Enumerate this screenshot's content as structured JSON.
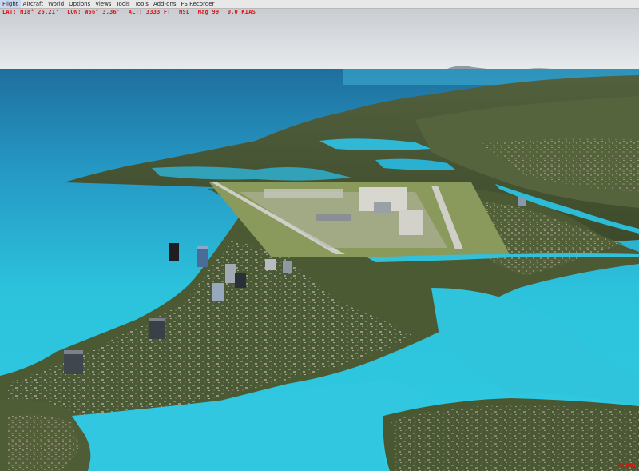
{
  "menu": {
    "items": [
      "Flight",
      "Aircraft",
      "World",
      "Options",
      "Views",
      "Tools",
      "Tools",
      "Add-ons",
      "FS Recorder"
    ]
  },
  "hud": {
    "lat": "LAT: N18° 26.21'",
    "lon": "LON: W66° 3.36'",
    "alt": "ALT: 3333 FT",
    "ref": "MSL",
    "mag": "Mag 99",
    "speed": "0.0 KIAS"
  },
  "status": {
    "label": "SLEW"
  },
  "colors": {
    "sky_top": "#c8ccd2",
    "sky_horizon": "#e8eaec",
    "ocean_deep": "#1e6c9c",
    "ocean_shallow": "#2cc4dc",
    "land_dark": "#3e4a2c",
    "land_mid": "#5c6a3c",
    "land_light": "#7e8a5a",
    "airport_grass": "#8a9a5c",
    "runway": "#c9c9c2",
    "hud_text": "#e01010"
  }
}
